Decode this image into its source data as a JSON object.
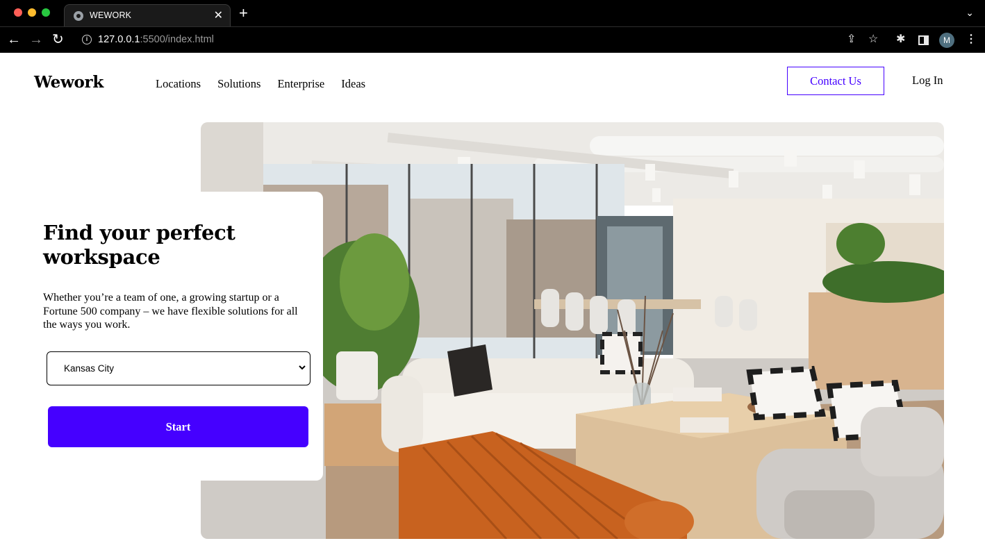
{
  "browser": {
    "tab_title": "WEWORK",
    "url_host": "127.0.0.1",
    "url_path": ":5500/index.html",
    "profile_initial": "M"
  },
  "header": {
    "logo": "Wework",
    "nav": [
      "Locations",
      "Solutions",
      "Enterprise",
      "Ideas"
    ],
    "contact_label": "Contact Us",
    "login_label": "Log In"
  },
  "hero": {
    "title": "Find your perfect workspace",
    "description": "Whether you’re a team of one, a growing startup or a Fortune 500 company – we have flexible solutions for all the ways you work.",
    "location_select": {
      "selected": "Kansas City"
    },
    "start_label": "Start"
  },
  "colors": {
    "accent": "#4500ff",
    "sofa_orange": "#c8621f"
  },
  "icons": {
    "globe": "globe-icon",
    "close": "close-icon",
    "back": "back-arrow-icon",
    "forward": "forward-arrow-icon",
    "reload": "reload-icon",
    "info": "info-icon",
    "share": "share-icon",
    "star": "star-icon",
    "extensions": "puzzle-icon",
    "sidebar": "sidebar-icon",
    "menu": "kebab-menu-icon"
  }
}
